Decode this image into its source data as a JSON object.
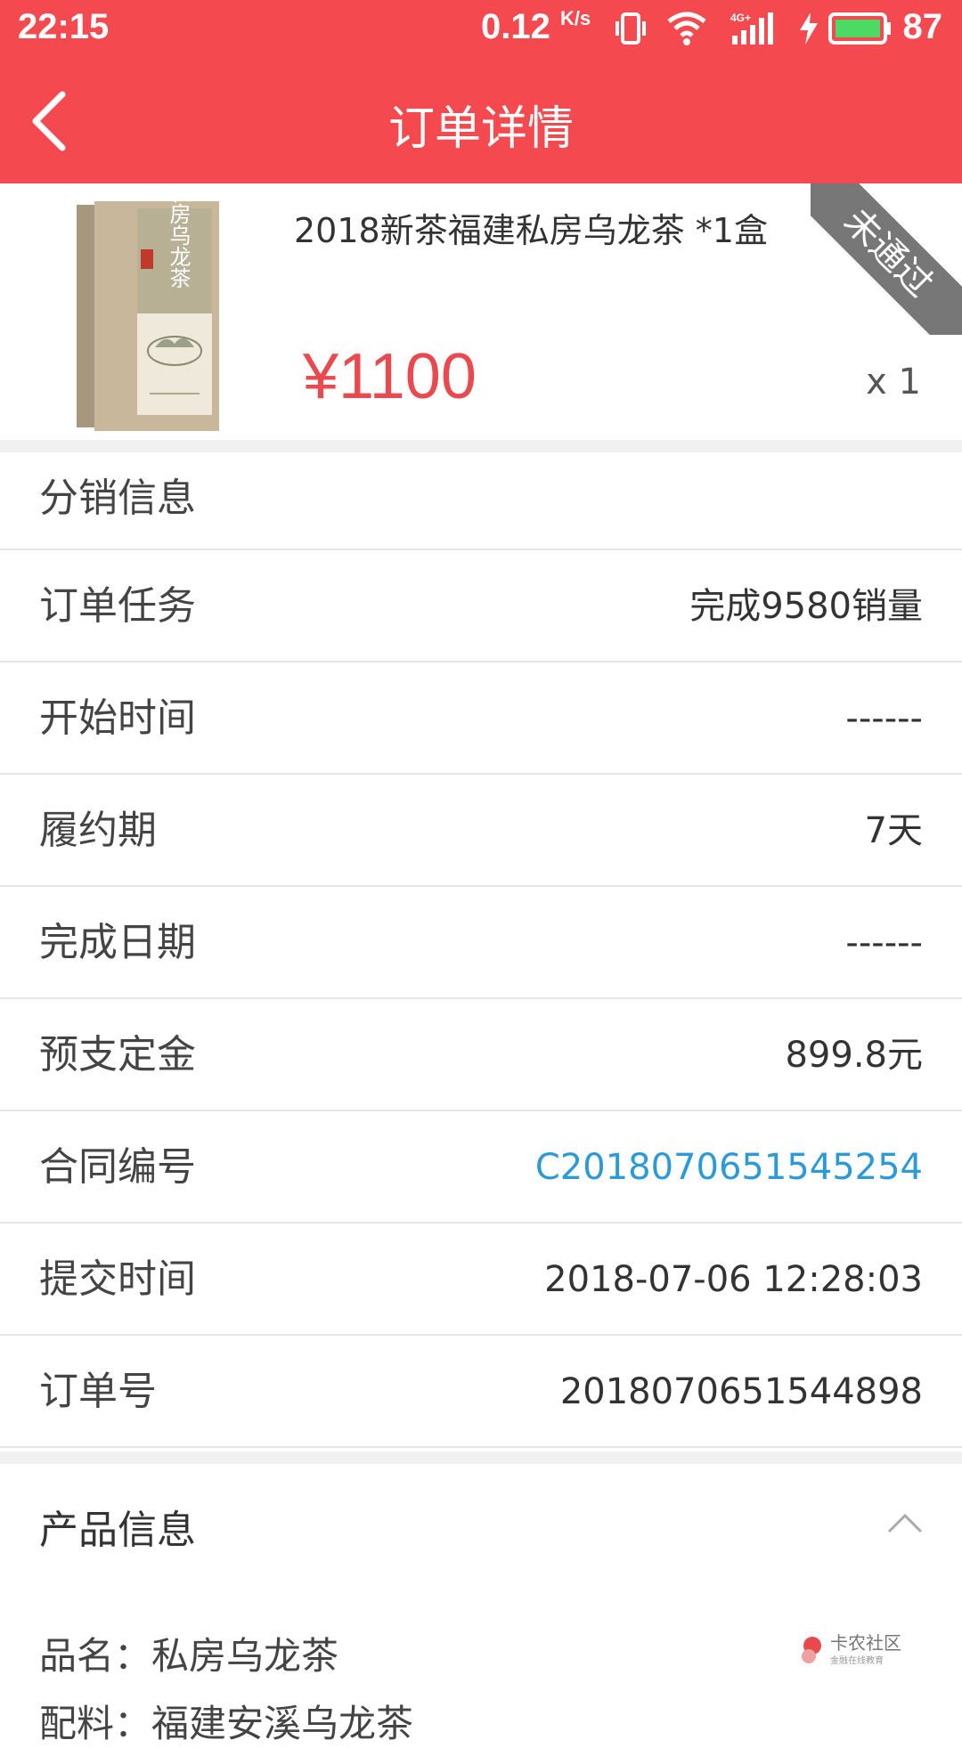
{
  "status_bar": {
    "time": "22:15",
    "speed": "0.12",
    "speed_unit": "K/s",
    "battery": "87"
  },
  "nav": {
    "title": "订单详情"
  },
  "product": {
    "name": "2018新茶福建私房乌龙茶 *1盒",
    "price": "¥1100",
    "quantity": "x 1",
    "status_ribbon": "未通过",
    "box_text": "私房乌龙茶"
  },
  "section_distribution": {
    "title": "分销信息",
    "rows": [
      {
        "label": "订单任务",
        "value": "完成9580销量"
      },
      {
        "label": "开始时间",
        "value": "------"
      },
      {
        "label": "履约期",
        "value": "7天"
      },
      {
        "label": "完成日期",
        "value": "------"
      },
      {
        "label": "预支定金",
        "value": "899.8元"
      },
      {
        "label": "合同编号",
        "value": "C2018070651545254"
      },
      {
        "label": "提交时间",
        "value": "2018-07-06 12:28:03"
      },
      {
        "label": "订单号",
        "value": "2018070651544898"
      }
    ]
  },
  "section_product": {
    "title": "产品信息",
    "name_line": "品名：私房乌龙茶",
    "next_line": "配料：福建安溪乌龙茶"
  },
  "watermark": {
    "text": "卡农社区",
    "sub": "金融在线教育"
  },
  "colors": {
    "header_red": "#f44a4f",
    "price_red": "#e84a4f",
    "link_blue": "#2c9ad8",
    "ribbon_gray": "#777777"
  }
}
